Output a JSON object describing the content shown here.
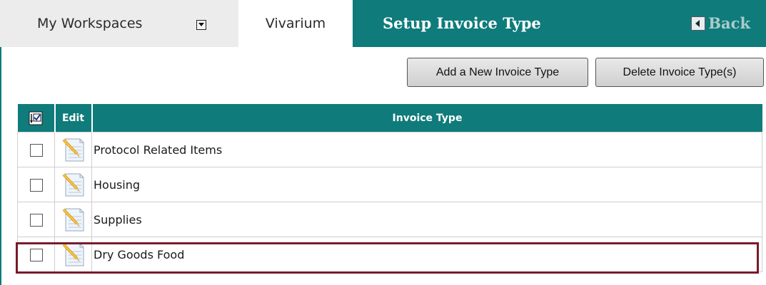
{
  "tabs": {
    "workspaces_label": "My Workspaces",
    "vivarium_label": "Vivarium"
  },
  "page": {
    "title": "Setup Invoice Type",
    "back_label": "Back"
  },
  "actions": {
    "add_label": "Add a New Invoice Type",
    "delete_label": "Delete Invoice Type(s)"
  },
  "table": {
    "headers": {
      "edit": "Edit",
      "invoice_type": "Invoice Type"
    },
    "rows": [
      {
        "name": "Protocol Related Items",
        "checked": false
      },
      {
        "name": "Housing",
        "checked": false
      },
      {
        "name": "Supplies",
        "checked": false
      },
      {
        "name": "Dry Goods Food",
        "checked": false,
        "highlighted": true
      }
    ]
  },
  "colors": {
    "accent": "#0f7b7b",
    "highlight_border": "#7a1a2a",
    "tab_background": "#ececec"
  },
  "icons": {
    "select_all": "select-all-checkbox-icon",
    "dropdown": "chevron-down-icon",
    "back": "arrow-left-icon",
    "edit": "notepad-pencil-icon"
  }
}
